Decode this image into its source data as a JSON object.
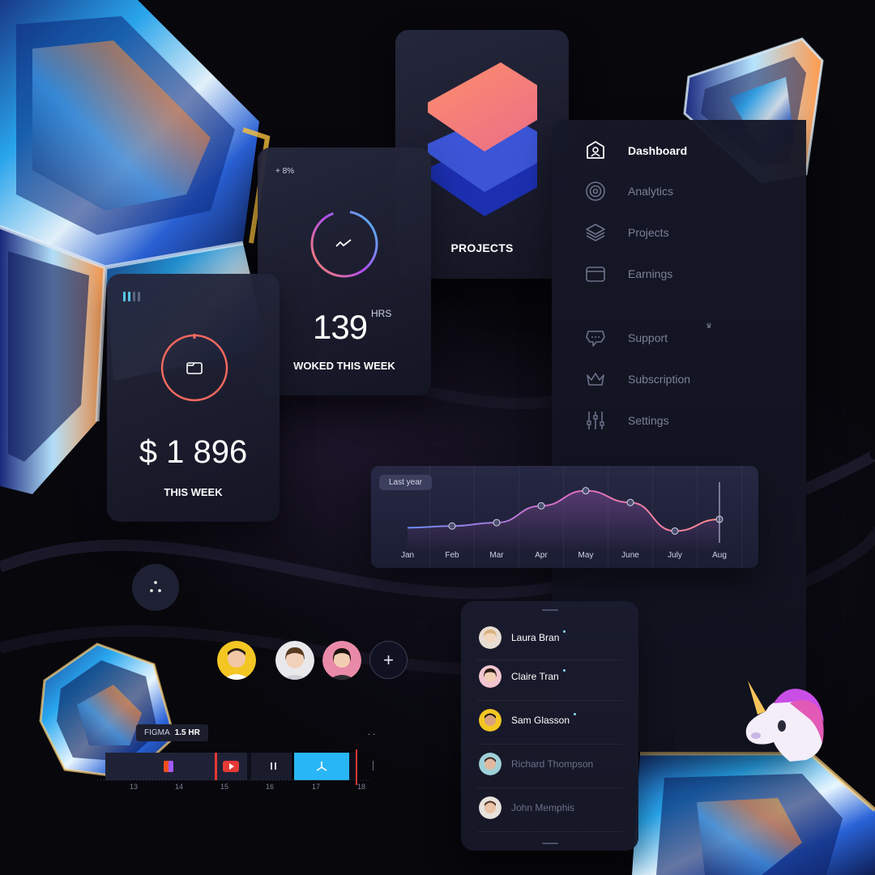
{
  "projects": {
    "label": "PROJECTS"
  },
  "hours": {
    "change": "+ 8%",
    "value": "139",
    "unit": "HRS",
    "label": "WOKED THIS WEEK"
  },
  "earnings": {
    "value": "$ 1 896",
    "label": "THIS WEEK"
  },
  "sidebar": {
    "items": [
      {
        "label": "Dashboard",
        "icon": "user-icon",
        "active": true
      },
      {
        "label": "Analytics",
        "icon": "target-icon"
      },
      {
        "label": "Projects",
        "icon": "layers-icon"
      },
      {
        "label": "Earnings",
        "icon": "wallet-icon"
      },
      {
        "label": "Support",
        "icon": "chat-icon"
      },
      {
        "label": "Subscription",
        "icon": "crown-icon"
      },
      {
        "label": "Settings",
        "icon": "sliders-icon"
      }
    ]
  },
  "chart": {
    "filter_label": "Last year"
  },
  "chart_data": {
    "type": "line",
    "categories": [
      "Jan",
      "Feb",
      "Mar",
      "Apr",
      "May",
      "June",
      "July",
      "Aug"
    ],
    "values": [
      18,
      20,
      24,
      44,
      62,
      48,
      14,
      28
    ],
    "ylim": [
      0,
      80
    ],
    "grid": true,
    "colors": {
      "line_start": "#6a8cf5",
      "line_mid": "#d86bc3",
      "line_end": "#ff8a8a"
    }
  },
  "contacts": [
    {
      "name": "Laura Bran",
      "online": true
    },
    {
      "name": "Claire Tran",
      "online": true
    },
    {
      "name": "Sam Glasson",
      "online": true
    },
    {
      "name": "Richard Thompson",
      "online": false
    },
    {
      "name": "John Memphis",
      "online": false
    }
  ],
  "timeline": {
    "tooltip_app": "FIGMA",
    "tooltip_time": "1.5 HR",
    "ticks": [
      "13",
      "14",
      "15",
      "16",
      "17",
      "18"
    ]
  },
  "colors": {
    "accent_blue": "#29b6f6",
    "accent_red": "#e53935",
    "background": "#07070c"
  }
}
